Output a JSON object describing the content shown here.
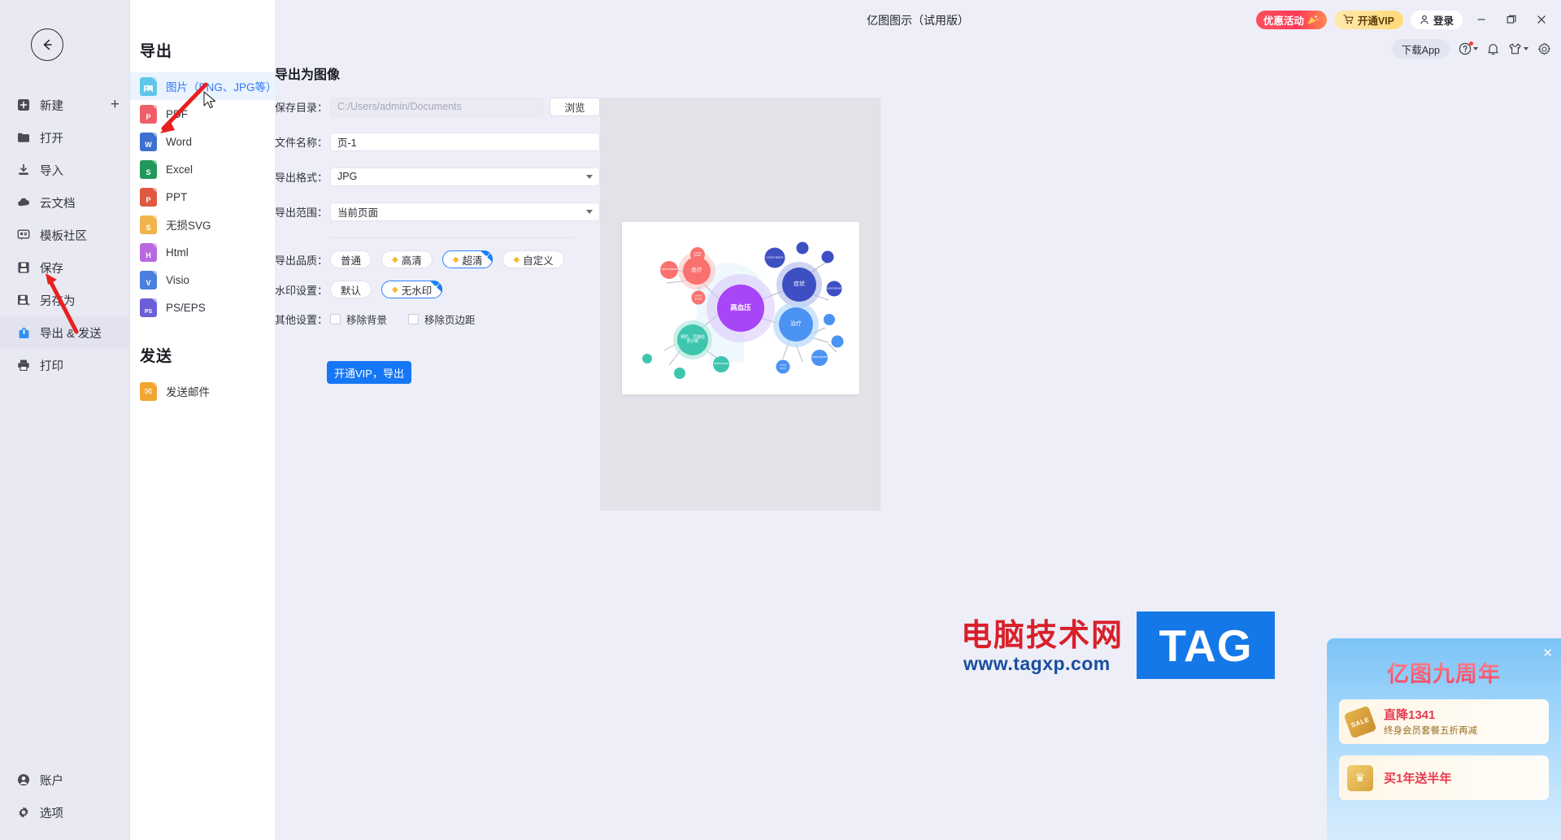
{
  "window": {
    "title": "亿图图示（试用版）",
    "minimize": "—",
    "maximize": "❐",
    "close": "✕"
  },
  "topbar": {
    "sale_label": "优惠活动",
    "vip_label": "开通VIP",
    "login_label": "登录",
    "download_app_label": "下载App",
    "help_icon": "help-circle-icon",
    "bell_icon": "bell-icon",
    "theme_icon": "shirt-icon",
    "settings_icon": "gear-icon"
  },
  "rail": {
    "back_icon": "back-arrow-icon",
    "items": [
      {
        "label": "新建",
        "icon": "plus-square-icon",
        "trailing": "+"
      },
      {
        "label": "打开",
        "icon": "folder-icon"
      },
      {
        "label": "导入",
        "icon": "import-icon"
      },
      {
        "label": "云文档",
        "icon": "cloud-icon"
      },
      {
        "label": "模板社区",
        "icon": "community-icon"
      },
      {
        "label": "保存",
        "icon": "save-icon"
      },
      {
        "label": "另存为",
        "icon": "save-as-icon"
      },
      {
        "label": "导出 & 发送",
        "icon": "export-icon",
        "active": true
      },
      {
        "label": "打印",
        "icon": "printer-icon"
      }
    ],
    "bottom_items": [
      {
        "label": "账户",
        "icon": "user-circle-icon"
      },
      {
        "label": "选项",
        "icon": "gear-icon"
      }
    ]
  },
  "formats": {
    "export_heading": "导出",
    "send_heading": "发送",
    "items": [
      {
        "label": "图片（PNG、JPG等）",
        "color": "#5ec7e8",
        "glyph": "",
        "active": true
      },
      {
        "label": "PDF",
        "color": "#ef5f6b",
        "glyph": "P"
      },
      {
        "label": "Word",
        "color": "#3d6fd0",
        "glyph": "W"
      },
      {
        "label": "Excel",
        "color": "#22975c",
        "glyph": "S"
      },
      {
        "label": "PPT",
        "color": "#e0583f",
        "glyph": "P"
      },
      {
        "label": "无损SVG",
        "color": "#f0b councillor",
        "glyph": "S"
      },
      {
        "label": "Html",
        "color": "#b969e0",
        "glyph": "H"
      },
      {
        "label": "Visio",
        "color": "#4a7fe0",
        "glyph": "V"
      },
      {
        "label": "PS/EPS",
        "color": "#6b5fd8",
        "glyph": "PS"
      }
    ],
    "send_items": [
      {
        "label": "发送邮件",
        "color": "#f0a630",
        "glyph": "✉"
      }
    ]
  },
  "export_form": {
    "heading": "导出为图像",
    "save_dir_label": "保存目录：",
    "save_dir_value": "C:/Users/admin/Documents",
    "browse_label": "浏览",
    "filename_label": "文件名称：",
    "filename_value": "页-1",
    "format_label": "导出格式：",
    "format_value": "JPG",
    "range_label": "导出范围：",
    "range_value": "当前页面",
    "quality_label": "导出品质：",
    "quality_options": [
      {
        "label": "普通",
        "vip": false,
        "selected": false
      },
      {
        "label": "高清",
        "vip": true,
        "selected": false
      },
      {
        "label": "超清",
        "vip": true,
        "selected": true
      },
      {
        "label": "自定义",
        "vip": true,
        "selected": false
      }
    ],
    "watermark_label": "水印设置：",
    "watermark_options": [
      {
        "label": "默认",
        "vip": false,
        "selected": false
      },
      {
        "label": "无水印",
        "vip": true,
        "selected": true
      }
    ],
    "other_label": "其他设置：",
    "other_options": [
      {
        "label": "移除背景",
        "checked": false
      },
      {
        "label": "移除页边距",
        "checked": false
      }
    ],
    "export_button": "开通VIP，导出"
  },
  "diagram": {
    "center": "高血压",
    "nodes": [
      {
        "label": "医疗",
        "color": "#f9726f"
      },
      {
        "label": "症状",
        "color": "#3e4fc4"
      },
      {
        "label": "治疗",
        "color": "#4b93f2"
      },
      {
        "label": "预防、早期检查诊断",
        "color": "#3ec5ae"
      }
    ],
    "leaf_text": "Lorem Ipsum"
  },
  "promo": {
    "title": "亿图九周年",
    "close_icon": "close-icon",
    "cards": [
      {
        "headline": "直降1341",
        "sub": "终身会员套餐五折再减",
        "tag": "SALE"
      },
      {
        "headline": "买1年送半年",
        "sub": "",
        "tag": "CROWN"
      }
    ]
  },
  "watermark": {
    "site_cn": "电脑技术网",
    "site_url": "www.tagxp.com",
    "tag": "TAG"
  }
}
